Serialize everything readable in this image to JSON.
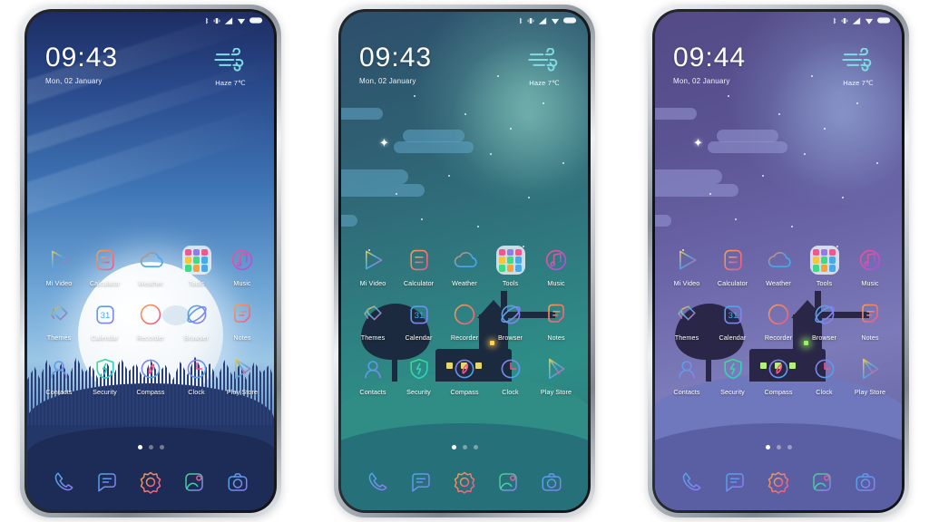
{
  "scene": {
    "description": "Three Android smartphones side by side showing a MIUI-style home screen theme preview",
    "phone_count": 3
  },
  "statusbar": {
    "icons": [
      "bluetooth-icon",
      "vibrate-icon",
      "signal-icon",
      "wifi-icon",
      "battery-icon"
    ]
  },
  "phones": [
    {
      "id": "phone-left",
      "theme": "blue-moon",
      "accent": "#3f76b6",
      "clock": {
        "time": "09:43",
        "date": "Mon, 02 January"
      },
      "weather": {
        "icon": "haze-wind-icon",
        "text": "Haze  7℃",
        "condition": "Haze",
        "temperature": "7℃"
      }
    },
    {
      "id": "phone-center",
      "theme": "teal-village",
      "accent": "#2f8d86",
      "clock": {
        "time": "09:43",
        "date": "Mon, 02 January"
      },
      "weather": {
        "icon": "haze-wind-icon",
        "text": "Haze  7℃",
        "condition": "Haze",
        "temperature": "7℃"
      }
    },
    {
      "id": "phone-right",
      "theme": "purple-village",
      "accent": "#6f77bd",
      "clock": {
        "time": "09:44",
        "date": "Mon, 02 January"
      },
      "weather": {
        "icon": "haze-wind-icon",
        "text": "Haze  7℃",
        "condition": "Haze",
        "temperature": "7℃"
      }
    }
  ],
  "home": {
    "rows": [
      [
        {
          "label": "Mi Video",
          "icon": "mi-video-icon"
        },
        {
          "label": "Calculator",
          "icon": "calculator-icon"
        },
        {
          "label": "Weather",
          "icon": "weather-cloud-icon"
        },
        {
          "label": "Tools",
          "icon": "tools-folder-icon",
          "type": "folder"
        },
        {
          "label": "Music",
          "icon": "music-note-icon"
        }
      ],
      [
        {
          "label": "Themes",
          "icon": "themes-icon"
        },
        {
          "label": "Calendar",
          "icon": "calendar-icon",
          "badge": "31"
        },
        {
          "label": "Recorder",
          "icon": "recorder-icon"
        },
        {
          "label": "Browser",
          "icon": "browser-planet-icon"
        },
        {
          "label": "Notes",
          "icon": "notes-icon"
        }
      ],
      [
        {
          "label": "Contacts",
          "icon": "contacts-icon"
        },
        {
          "label": "Security",
          "icon": "security-shield-icon"
        },
        {
          "label": "Compass",
          "icon": "compass-icon"
        },
        {
          "label": "Clock",
          "icon": "clock-icon"
        },
        {
          "label": "Play Store",
          "icon": "play-store-icon"
        }
      ]
    ],
    "page_indicator": {
      "total": 3,
      "active": 1
    },
    "dock": [
      {
        "label": "Phone",
        "icon": "phone-handset-icon"
      },
      {
        "label": "Messages",
        "icon": "messages-icon"
      },
      {
        "label": "Settings",
        "icon": "settings-gear-icon"
      },
      {
        "label": "Gallery",
        "icon": "gallery-icon"
      },
      {
        "label": "Camera",
        "icon": "camera-icon"
      }
    ]
  },
  "colors": {
    "icon_blue": "#4aa8e8",
    "icon_orange": "#f08a4b",
    "icon_pink": "#f0568f",
    "icon_green": "#3ddc84",
    "icon_yellow": "#f5c53d",
    "icon_purple": "#9a7cf0",
    "label_white": "#ffffff"
  }
}
